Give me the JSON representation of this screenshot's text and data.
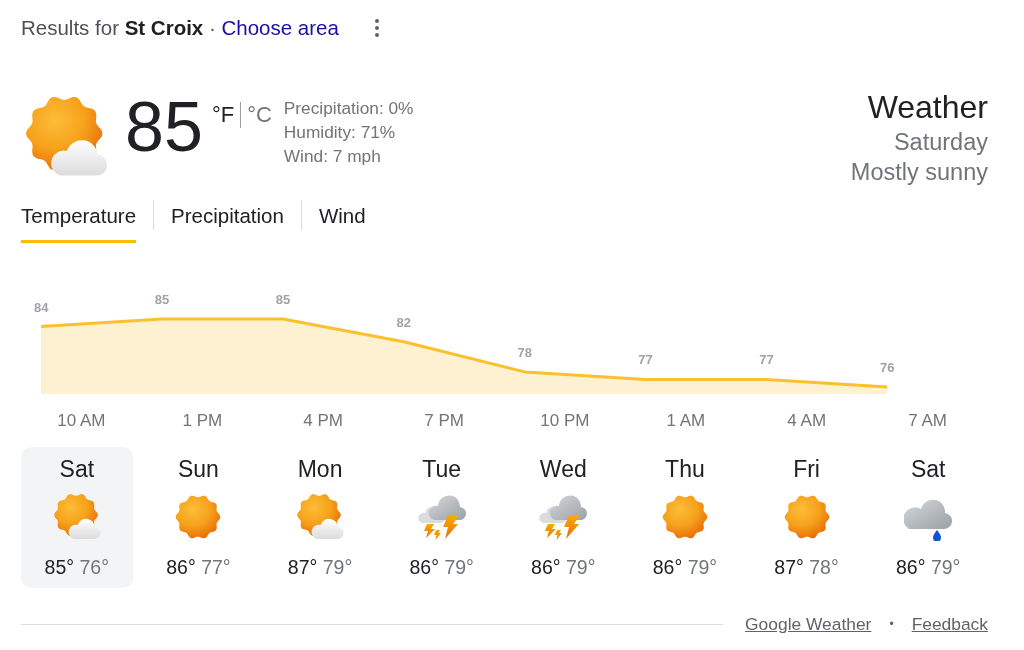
{
  "header": {
    "text": "Results for **St Croix** ·",
    "link": "Choose area"
  },
  "current": {
    "kind": "partly-sunny",
    "temperature": "85",
    "units": [
      {
        "label": "°F",
        "selected": true
      },
      {
        "label": "°C",
        "selected": false
      }
    ],
    "details": [
      "Precipitation: 0%",
      "Humidity: 71%",
      "Wind: 7 mph"
    ]
  },
  "summary": {
    "title": "Weather",
    "day": "Saturday",
    "condition": "Mostly sunny"
  },
  "tabs": [
    {
      "label": "Temperature",
      "selected": true
    },
    {
      "label": "Precipitation",
      "selected": false
    },
    {
      "label": "Wind",
      "selected": false
    }
  ],
  "chart": {
    "chart_data": {
      "type": "area",
      "data_labels": true,
      "categories": [
        null,
        "10 AM",
        null,
        null,
        "1 PM",
        null,
        null,
        "4 PM",
        null,
        null,
        "7 PM",
        null,
        null,
        "10 PM",
        null,
        null,
        "1 AM",
        null,
        null,
        "4 AM",
        null,
        null,
        "7 AM",
        null
      ],
      "series": [
        {
          "color": "#fbc02d",
          "values": [
            84,
            null,
            null,
            85,
            null,
            null,
            85,
            null,
            null,
            82,
            null,
            null,
            78,
            null,
            null,
            77,
            null,
            null,
            77,
            null,
            null,
            76,
            null,
            null
          ]
        }
      ]
    }
  },
  "days": [
    {
      "name": "Sat",
      "kind": "partly-sunny",
      "high": "85°",
      "low": "76°",
      "selected": true
    },
    {
      "name": "Sun",
      "kind": "sunny",
      "high": "86°",
      "low": "77°",
      "selected": false
    },
    {
      "name": "Mon",
      "kind": "partly-sunny",
      "high": "87°",
      "low": "79°",
      "selected": false
    },
    {
      "name": "Tue",
      "kind": "thunderstorm",
      "high": "86°",
      "low": "79°",
      "selected": false
    },
    {
      "name": "Wed",
      "kind": "thunderstorm",
      "high": "86°",
      "low": "79°",
      "selected": false
    },
    {
      "name": "Thu",
      "kind": "sunny",
      "high": "86°",
      "low": "79°",
      "selected": false
    },
    {
      "name": "Fri",
      "kind": "sunny",
      "high": "87°",
      "low": "78°",
      "selected": false
    },
    {
      "name": "Sat",
      "kind": "rain",
      "high": "86°",
      "low": "79°",
      "selected": false
    }
  ],
  "footer": {
    "links": [
      "Google Weather",
      "Feedback"
    ],
    "separator": "•"
  }
}
